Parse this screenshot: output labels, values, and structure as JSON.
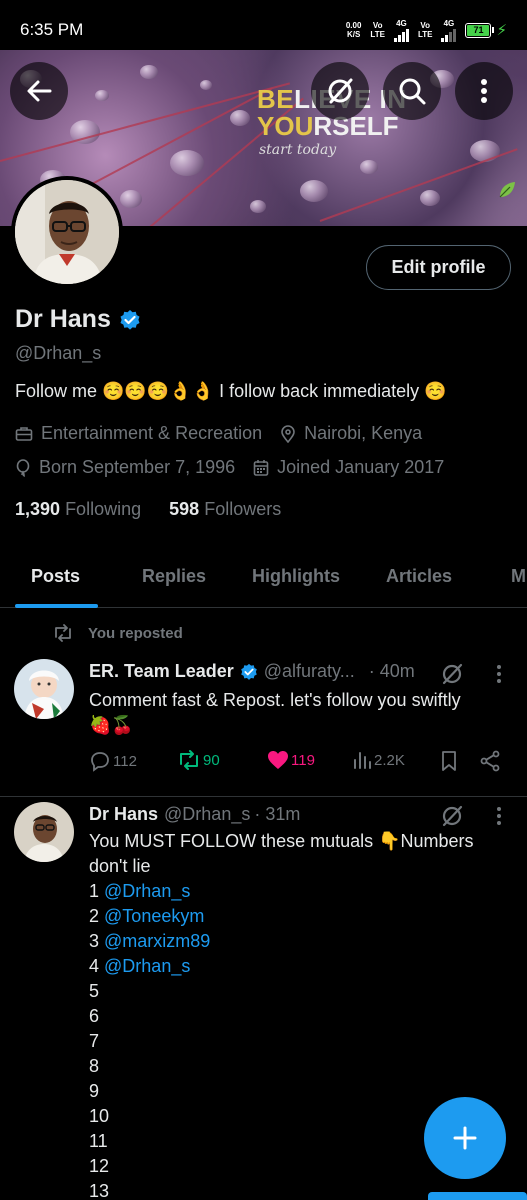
{
  "status_bar": {
    "time": "6:35 PM",
    "speed_value": "0.00",
    "speed_unit": "K/S",
    "net1_top": "Vo",
    "net1_bottom": "LTE",
    "net1_gen": "4G",
    "net2_top": "Vo",
    "net2_bottom": "LTE",
    "net2_gen": "4G",
    "battery": "71"
  },
  "banner": {
    "line1_a": "BE",
    "line1_b": "LIEVE IN",
    "line2_a": "YOU",
    "line2_b": "RSELF",
    "line3": "start today"
  },
  "profile": {
    "edit_label": "Edit profile",
    "name": "Dr Hans",
    "handle": "@Drhan_s",
    "bio": "Follow me ☺️☺️☺️👌👌  I follow back immediately ☺️",
    "category": "Entertainment & Recreation",
    "location": "Nairobi, Kenya",
    "born": "Born September 7, 1996",
    "joined": "Joined January 2017",
    "following_count": "1,390",
    "following_label": "Following",
    "followers_count": "598",
    "followers_label": "Followers"
  },
  "tabs": [
    "Posts",
    "Replies",
    "Highlights",
    "Articles",
    "M"
  ],
  "posts": [
    {
      "repost_label": "You reposted",
      "name": "ER. Team Leader",
      "handle": "@alfuraty...",
      "time": "· 40m",
      "text_line1": "Comment fast & Repost. let's follow you swiftly",
      "text_line2": "🍓🍒",
      "replies": "112",
      "reposts": "90",
      "likes": "119",
      "views": "2.2K"
    },
    {
      "name": "Dr Hans",
      "handle": "@Drhan_s",
      "time": "· 31m",
      "text_line1": "You MUST FOLLOW these mutuals 👇Numbers",
      "text_line2": "don't lie",
      "list": [
        {
          "num": "1",
          "mention": "@Drhan_s"
        },
        {
          "num": "2",
          "mention": "@Toneekym"
        },
        {
          "num": "3",
          "mention": "@marxizm89"
        },
        {
          "num": "4",
          "mention": "@Drhan_s"
        },
        {
          "num": "5",
          "mention": ""
        },
        {
          "num": "6",
          "mention": ""
        },
        {
          "num": "7",
          "mention": ""
        },
        {
          "num": "8",
          "mention": ""
        },
        {
          "num": "9",
          "mention": ""
        },
        {
          "num": "10",
          "mention": ""
        },
        {
          "num": "11",
          "mention": ""
        },
        {
          "num": "12",
          "mention": ""
        },
        {
          "num": "13",
          "mention": ""
        }
      ]
    }
  ],
  "colors": {
    "accent": "#1d9bf0",
    "repost_green": "#00ba7c",
    "like_pink": "#f91880",
    "muted": "#71767b"
  }
}
